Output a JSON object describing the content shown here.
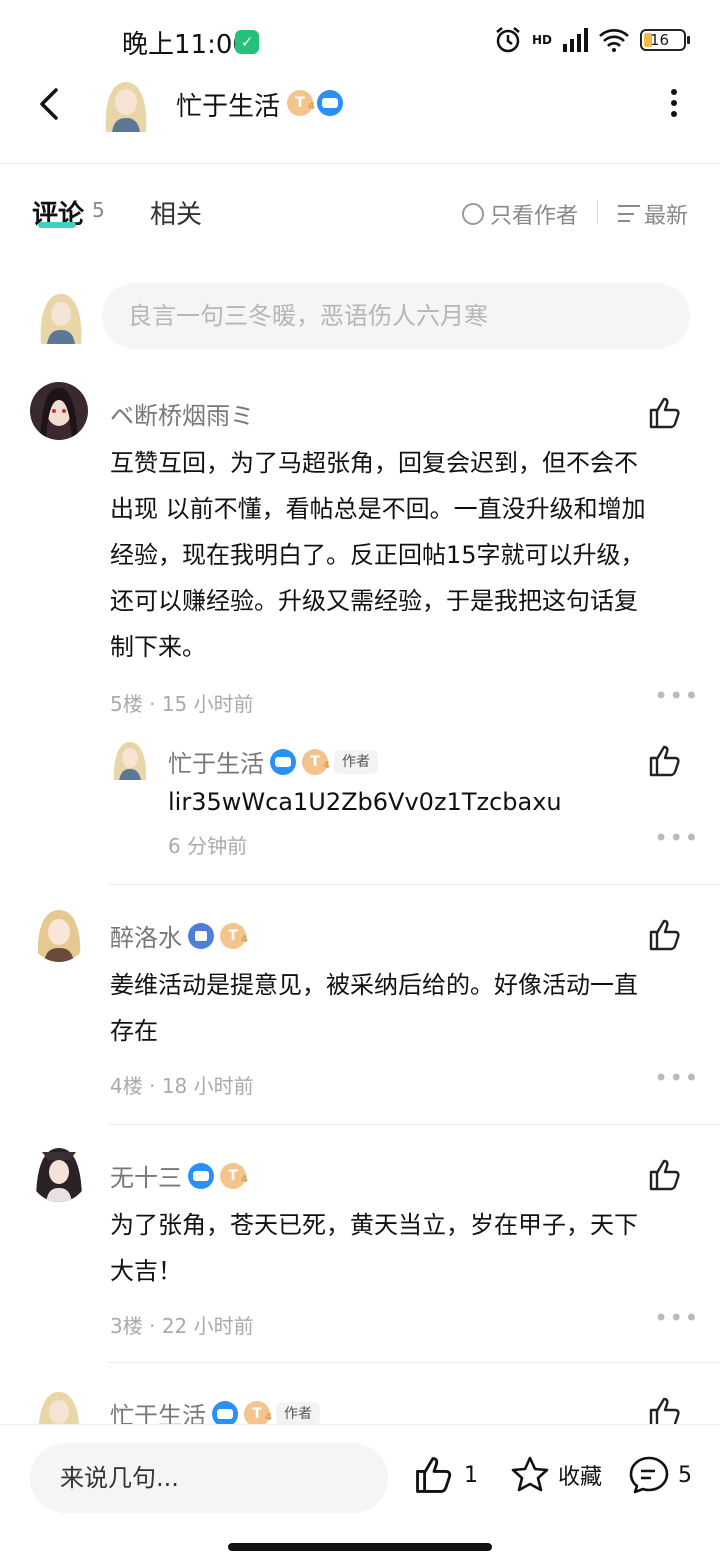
{
  "status_bar": {
    "time": "晚上11:00",
    "network": "HD",
    "battery": "16"
  },
  "header": {
    "title": "忙于生活",
    "badge_level": "T"
  },
  "tabs": {
    "comments_label": "评论",
    "comments_count": "5",
    "related_label": "相关",
    "only_author": "只看作者",
    "sort_label": "最新"
  },
  "reply_box": {
    "placeholder": "良言一句三冬暖，恶语伤人六月寒"
  },
  "comments": [
    {
      "user": "ベ断桥烟雨ミ",
      "text_lines": [
        "互赞互回，为了马超张角，回复会迟到，但不会不",
        "出现 以前不懂，看帖总是不回。一直没升级和增加",
        "经验，现在我明白了。反正回帖15字就可以升级，",
        "还可以赚经验。升级又需经验，于是我把这句话复",
        "制下来。"
      ],
      "floor": "5楼",
      "dot": "·",
      "time": "15 小时前",
      "reply": {
        "user": "忙于生活",
        "author_tag": "作者",
        "text": "lir35wWca1U2Zb6Vv0z1Tzcbaxu",
        "time": "6 分钟前"
      }
    },
    {
      "user": "醉洛水",
      "text_lines": [
        "姜维活动是提意见，被采纳后给的。好像活动一直",
        "存在"
      ],
      "floor": "4楼",
      "dot": "·",
      "time": "18 小时前"
    },
    {
      "user": "无十三",
      "text_lines": [
        "为了张角，苍天已死，黄天当立，岁在甲子，天下",
        "大吉！"
      ],
      "floor": "3楼",
      "dot": "·",
      "time": "22 小时前"
    },
    {
      "user": "忙于生活",
      "author_tag": "作者"
    }
  ],
  "bottom_bar": {
    "input_label": "来说几句...",
    "like_count": "1",
    "favorite_label": "收藏",
    "comment_count": "5"
  },
  "colors": {
    "accent": "#3ed0c0",
    "badge_blue": "#2a8ff7",
    "badge_gold": "#f3c48d"
  }
}
